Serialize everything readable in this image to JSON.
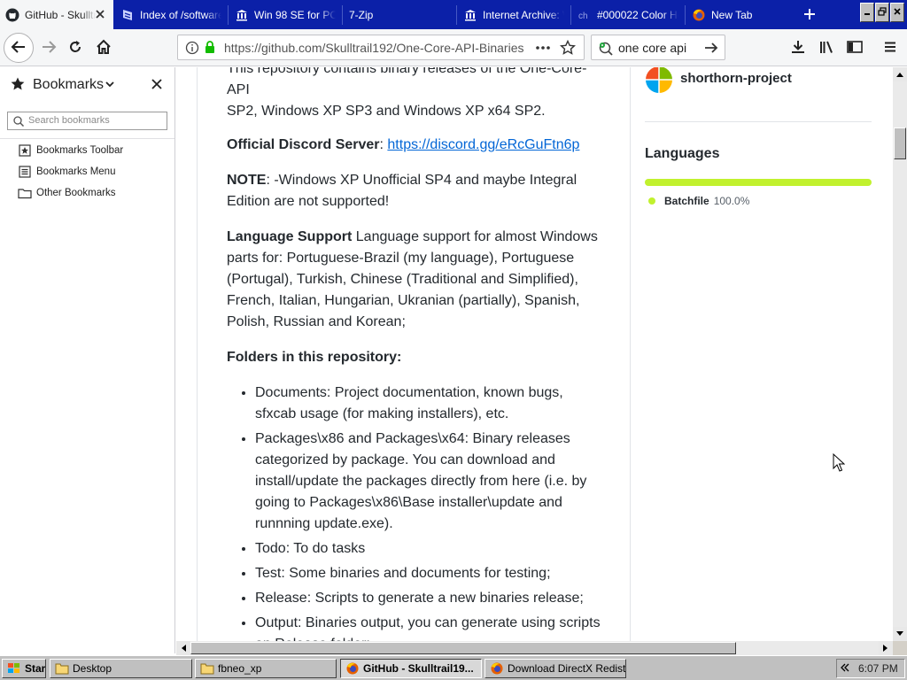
{
  "tabs": [
    {
      "title": "GitHub - Skulltrail192",
      "icon": "github-icon",
      "active": true
    },
    {
      "title": "Index of /software",
      "icon": "archive-icon"
    },
    {
      "title": "Win 98 SE for PCem",
      "icon": "museum-icon"
    },
    {
      "title": "7-Zip",
      "icon": "none"
    },
    {
      "title": "Internet Archive: Wayback",
      "icon": "museum-icon"
    },
    {
      "title": "#000022 Color Hex",
      "icon": "color-hex-icon"
    },
    {
      "title": "New Tab",
      "icon": "firefox-icon"
    }
  ],
  "navbar": {
    "url": "https://github.com/Skulltrail192/One-Core-API-Binaries",
    "search_text": "one core api"
  },
  "sidebar": {
    "title": "Bookmarks",
    "search_placeholder": "Search bookmarks",
    "items": [
      {
        "label": "Bookmarks Toolbar",
        "icon": "bookmarks-toolbar-icon"
      },
      {
        "label": "Bookmarks Menu",
        "icon": "bookmarks-menu-icon"
      },
      {
        "label": "Other Bookmarks",
        "icon": "folder-icon"
      }
    ]
  },
  "readme": {
    "intro": "This repository contains binary releases of the One-Core-API for Windows XP SP2, Windows XP SP3 and Windows XP x64 SP2.",
    "intro_visible_top": "This repository contains binary releases of the One-Core-API",
    "intro_visible_bottom": "SP2, Windows XP SP3 and Windows XP x64 SP2.",
    "discord_label": "Official Discord Server",
    "discord_sep": ": ",
    "discord_link": "https://discord.gg/eRcGuFtn6p",
    "note_label": "NOTE",
    "note_text": ": -Windows XP Unofficial SP4 and maybe Integral Edition are not supported!",
    "lang_label": "Language Support",
    "lang_text": " Language support for almost Windows parts for: Portuguese-Brazil (my language), Portuguese (Portugal), Turkish, Chinese (Traditional and Simplified), French, Italian, Hungarian, Ukranian (partially), Spanish, Polish, Russian and Korean;",
    "folders_heading": "Folders in this repository:",
    "folders": [
      "Documents: Project documentation, known bugs, sfxcab usage (for making installers), etc.",
      "Packages\\x86 and Packages\\x64: Binary releases categorized by package. You can download and install/update the packages directly from here (i.e. by going to Packages\\x86\\Base installer\\update and runnning update.exe).",
      "Todo: To do tasks",
      "Test: Some binaries and documents for testing;",
      "Release: Scripts to generate a new binaries release;",
      "Output: Binaries output, you can generate using scripts on Release folder;"
    ]
  },
  "about": {
    "project_name": "shorthorn-project",
    "languages_heading": "Languages",
    "language": {
      "name": "Batchfile",
      "percent_label": "100.0%",
      "fraction": 1.0,
      "color": "#c1f12e"
    }
  },
  "taskbar": {
    "start_label": "Start",
    "buttons": [
      {
        "label": "Desktop",
        "icon": "folder-icon"
      },
      {
        "label": "fbneo_xp",
        "icon": "folder-icon"
      },
      {
        "label": "GitHub - Skulltrail19...",
        "icon": "firefox-icon",
        "pressed": true
      },
      {
        "label": "Download DirectX Redist ...",
        "icon": "firefox-icon"
      }
    ],
    "clock": "6:07 PM"
  }
}
